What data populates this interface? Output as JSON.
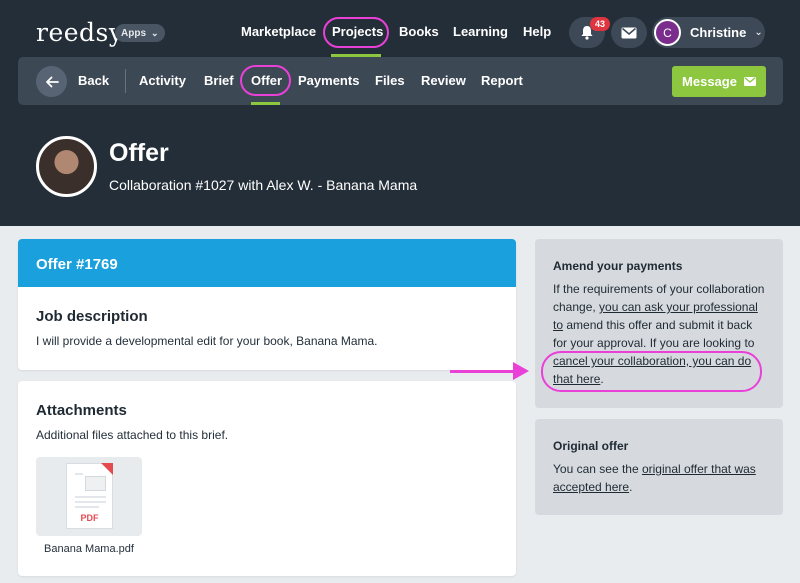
{
  "brand": {
    "logo": "reedsy",
    "apps_label": "Apps"
  },
  "topnav": {
    "items": [
      "Marketplace",
      "Projects",
      "Books",
      "Learning",
      "Help"
    ],
    "active": "Projects",
    "notifications_count": "43",
    "user_name": "Christine",
    "user_initial": "C"
  },
  "subnav": {
    "back_label": "Back",
    "tabs": [
      "Activity",
      "Brief",
      "Offer",
      "Payments",
      "Files",
      "Review",
      "Report"
    ],
    "active_tab": "Offer",
    "message_label": "Message"
  },
  "page": {
    "title": "Offer",
    "subtitle": "Collaboration #1027 with Alex W. - Banana Mama"
  },
  "offer_card": {
    "header": "Offer #1769",
    "job_heading": "Job description",
    "job_text": "I will provide a developmental edit for your book, Banana Mama."
  },
  "attachments": {
    "heading": "Attachments",
    "description": "Additional files attached to this brief.",
    "file_type": "PDF",
    "file_name": "Banana Mama.pdf"
  },
  "amend": {
    "heading": "Amend your payments",
    "text_1": "If the requirements of your collaboration change, ",
    "link_1": "you can ask your professional to",
    "text_2": " amend this offer and submit it back for your approval. If you are looking to ",
    "link_2": "cancel your collaboration, you can do that here",
    "text_3": "."
  },
  "original": {
    "heading": "Original offer",
    "text_1": "You can see the ",
    "link": "original offer that was accepted here",
    "text_2": "."
  },
  "colors": {
    "header_bg": "#242e38",
    "accent_green": "#8dc63f",
    "offer_blue": "#1aa0dc",
    "annotation_pink": "#e940d8",
    "badge_red": "#e0343f"
  },
  "icons": [
    "arrow-left-icon",
    "bell-icon",
    "envelope-icon",
    "chevron-down-icon",
    "pdf-file-icon"
  ]
}
